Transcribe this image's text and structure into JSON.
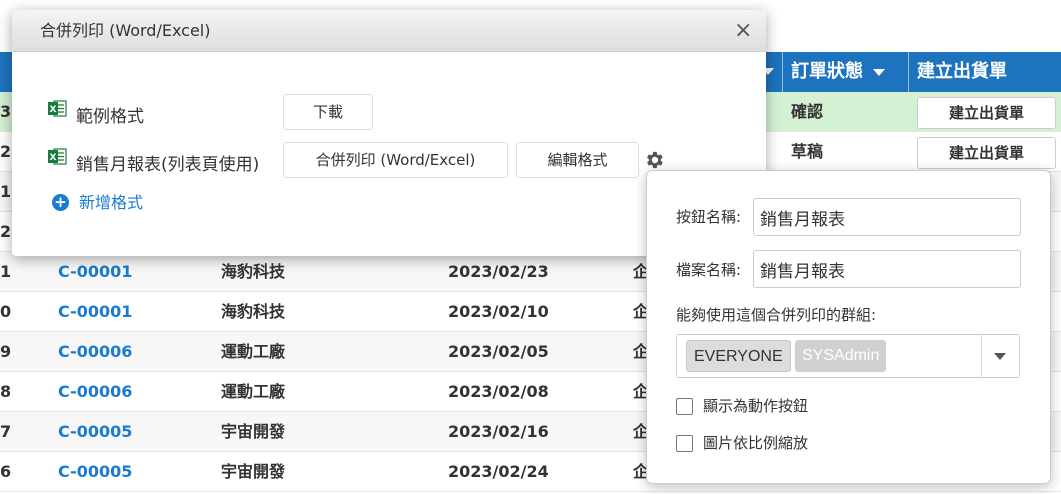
{
  "table": {
    "headers": [
      {
        "label": "訂單狀態"
      },
      {
        "label": "建立出貨單"
      }
    ],
    "rows": [
      {
        "id": "3",
        "customer": "",
        "name": "",
        "date": "",
        "employee": "",
        "status": "確認",
        "action": "建立出貨單"
      },
      {
        "id": "2",
        "customer": "",
        "name": "",
        "date": "",
        "employee": "",
        "status": "草稿",
        "action": "建立出貨單"
      },
      {
        "id": "1",
        "customer": "",
        "name": "",
        "date": "",
        "employee": "",
        "status": "",
        "action": ""
      },
      {
        "id": "2",
        "customer": "",
        "name": "",
        "date": "",
        "employee": "",
        "status": "",
        "action": ""
      },
      {
        "id": "1",
        "customer": "C-00001",
        "name": "海豹科技",
        "date": "2023/02/23",
        "employee": "企",
        "status": "",
        "action": ""
      },
      {
        "id": "0",
        "customer": "C-00001",
        "name": "海豹科技",
        "date": "2023/02/10",
        "employee": "企",
        "status": "",
        "action": ""
      },
      {
        "id": "9",
        "customer": "C-00006",
        "name": "運動工廠",
        "date": "2023/02/05",
        "employee": "企",
        "status": "",
        "action": ""
      },
      {
        "id": "8",
        "customer": "C-00006",
        "name": "運動工廠",
        "date": "2023/02/08",
        "employee": "企",
        "status": "",
        "action": ""
      },
      {
        "id": "7",
        "customer": "C-00005",
        "name": "宇宙開發",
        "date": "2023/02/16",
        "employee": "企",
        "status": "",
        "action": ""
      },
      {
        "id": "6",
        "customer": "C-00005",
        "name": "宇宙開發",
        "date": "2023/02/24",
        "employee": "企",
        "status": "",
        "action": ""
      }
    ]
  },
  "dialog": {
    "title": "合併列印 (Word/Excel)",
    "close_icon": "close-icon",
    "formats": [
      {
        "label": "範例格式",
        "icon": "excel-icon",
        "download_button": "下載"
      },
      {
        "label": "銷售月報表(列表頁使用)",
        "icon": "excel-icon",
        "merge_button": "合併列印 (Word/Excel)",
        "edit_button": "編輯格式",
        "settings_icon": "gear-icon"
      }
    ],
    "add_format": "新增格式",
    "add_icon": "plus-circle-icon"
  },
  "popover": {
    "button_name_label": "按鈕名稱:",
    "button_name_value": "銷售月報表",
    "file_name_label": "檔案名稱:",
    "file_name_value": "銷售月報表",
    "groups_label": "能夠使用這個合併列印的群組:",
    "groups": [
      "EVERYONE",
      "SYSAdmin"
    ],
    "show_as_action_label": "顯示為動作按鈕",
    "scale_images_label": "圖片依比例縮放"
  },
  "colors": {
    "header_bg": "#1e73be",
    "link": "#1a7bd0",
    "selected_row": "#d4f1d3",
    "excel_green": "#1d7a3e"
  }
}
